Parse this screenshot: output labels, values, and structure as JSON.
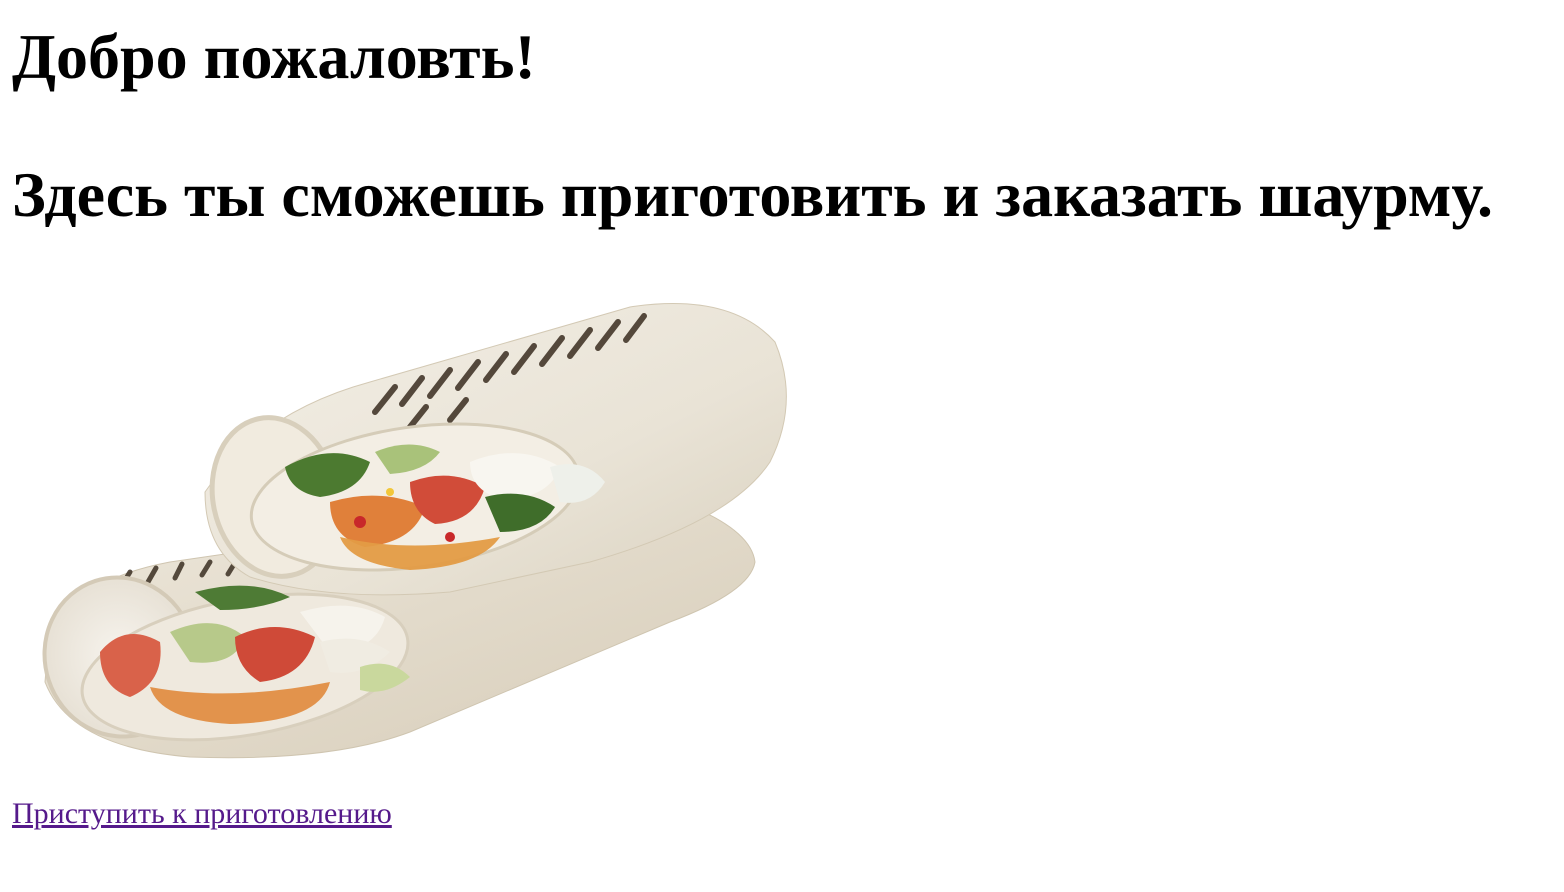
{
  "page": {
    "heading": "Добро пожаловть!",
    "subheading": "Здесь ты сможешь приготовить и заказать шаурму.",
    "image_icon": "shawarma-image",
    "link_text": "Приступить к приготовлению",
    "link_color": "#551a8b"
  }
}
